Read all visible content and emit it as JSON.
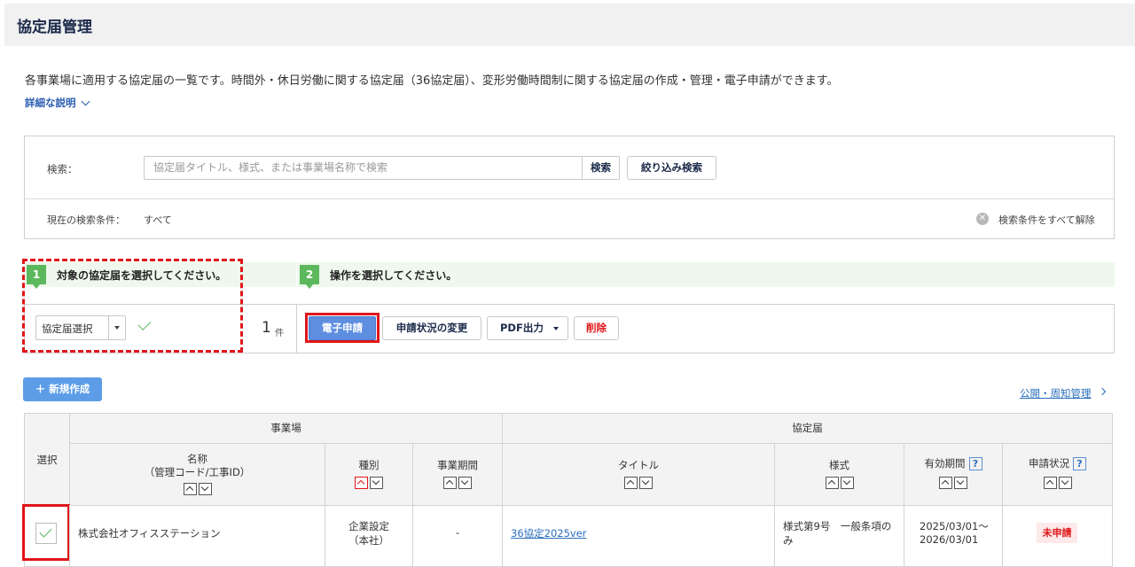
{
  "page": {
    "title": "協定届管理"
  },
  "intro": {
    "description": "各事業場に適用する協定届の一覧です。時間外・休日労働に関する協定届（36協定届）、変形労働時間制に関する協定届の作成・管理・電子申請ができます。",
    "detail_link": "詳細な説明"
  },
  "search": {
    "label": "検索：",
    "placeholder": "協定届タイトル、様式、または事業場名称で検索",
    "search_button": "検索",
    "filter_button": "絞り込み検索",
    "condition_label": "現在の検索条件：",
    "condition_value": "すべて",
    "clear_label": "検索条件をすべて解除"
  },
  "steps": [
    {
      "number": "1",
      "text": "対象の協定届を選択してください。"
    },
    {
      "number": "2",
      "text": "操作を選択してください。"
    }
  ],
  "actions": {
    "select_label": "協定届選択",
    "count": "1",
    "count_unit": "件",
    "e_filing": "電子申請",
    "change_status": "申請状況の変更",
    "pdf_output": "PDF出力",
    "delete": "削除"
  },
  "new_button": "＋ 新規作成",
  "publish_link": "公開・周知管理",
  "table": {
    "group_workplace": "事業場",
    "group_agreement": "協定届",
    "col_select": "選択",
    "col_name_line1": "名称",
    "col_name_line2": "（管理コード/工事ID）",
    "col_type": "種別",
    "col_period": "事業期間",
    "col_title": "タイトル",
    "col_format": "様式",
    "col_valid": "有効期間",
    "col_status": "申請状況",
    "help_icon": "?",
    "rows": [
      {
        "name": "株式会社オフィスステーション",
        "type_line1": "企業設定",
        "type_line2": "（本社）",
        "period": "-",
        "title": "36協定2025ver",
        "format_line1": "様式第9号　一般条項の",
        "format_line2": "み",
        "valid_line1": "2025/03/01～",
        "valid_line2": "2026/03/01",
        "status": "未申請"
      }
    ]
  },
  "colors": {
    "accent": "#5d8ee0",
    "danger": "#e0161a",
    "success": "#5cb85c",
    "step_bg": "#eef8ec"
  }
}
